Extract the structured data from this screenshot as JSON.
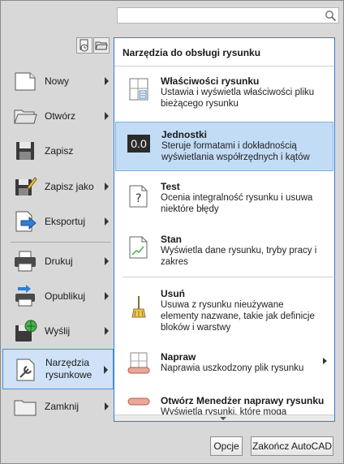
{
  "search": {
    "placeholder": ""
  },
  "left_menu": {
    "items": [
      {
        "label": "Nowy",
        "icon": "new-document-icon",
        "has_arrow": true
      },
      {
        "label": "Otwórz",
        "icon": "open-folder-icon",
        "has_arrow": true
      },
      {
        "label": "Zapisz",
        "icon": "save-icon",
        "has_arrow": false
      },
      {
        "label": "Zapisz jako",
        "icon": "save-as-icon",
        "has_arrow": true
      },
      {
        "label": "Eksportuj",
        "icon": "export-icon",
        "has_arrow": true
      },
      {
        "label": "Drukuj",
        "icon": "print-icon",
        "has_arrow": true
      },
      {
        "label": "Opublikuj",
        "icon": "publish-icon",
        "has_arrow": true
      },
      {
        "label": "Wyślij",
        "icon": "send-icon",
        "has_arrow": true
      },
      {
        "label": "Narzędzia rysunkowe",
        "icon": "drawing-utilities-icon",
        "has_arrow": true,
        "active": true
      },
      {
        "label": "Zamknij",
        "icon": "close-folder-icon",
        "has_arrow": true
      }
    ]
  },
  "panel": {
    "title": "Narzędzia do obsługi rysunku",
    "tools": [
      {
        "title": "Właściwości rysunku",
        "desc": "Ustawia i wyświetla właściwości pliku bieżącego rysunku",
        "icon": "drawing-properties-icon"
      },
      {
        "title": "Jednostki",
        "desc": "Steruje formatami i dokładnością wyświetlania współrzędnych i kątów",
        "icon": "units-icon",
        "icon_text": "0.0"
      },
      {
        "title": "Test",
        "desc": "Ocenia integralność rysunku i usuwa niektóre błędy",
        "icon": "audit-icon",
        "icon_text": "?"
      },
      {
        "title": "Stan",
        "desc": "Wyświetla dane rysunku, tryby pracy i zakres",
        "icon": "status-icon"
      },
      {
        "title": "Usuń",
        "desc": "Usuwa z rysunku nieużywane elementy nazwane, takie jak definicje bloków i warstwy",
        "icon": "purge-icon"
      },
      {
        "title": "Napraw",
        "desc": "Naprawia uszkodzony plik rysunku",
        "icon": "recover-icon"
      },
      {
        "title": "Otwórz Menedżer naprawy rysunku",
        "desc": "Wyświetla rysunki, które mogą wymagać",
        "icon": "drawing-recovery-icon"
      }
    ]
  },
  "buttons": {
    "options": "Opcje",
    "exit": "Zakończ AutoCAD"
  },
  "colors": {
    "highlight": "#c3dcf5",
    "panel_border": "#2f7fd6",
    "active_menu": "#cfe2f7"
  }
}
